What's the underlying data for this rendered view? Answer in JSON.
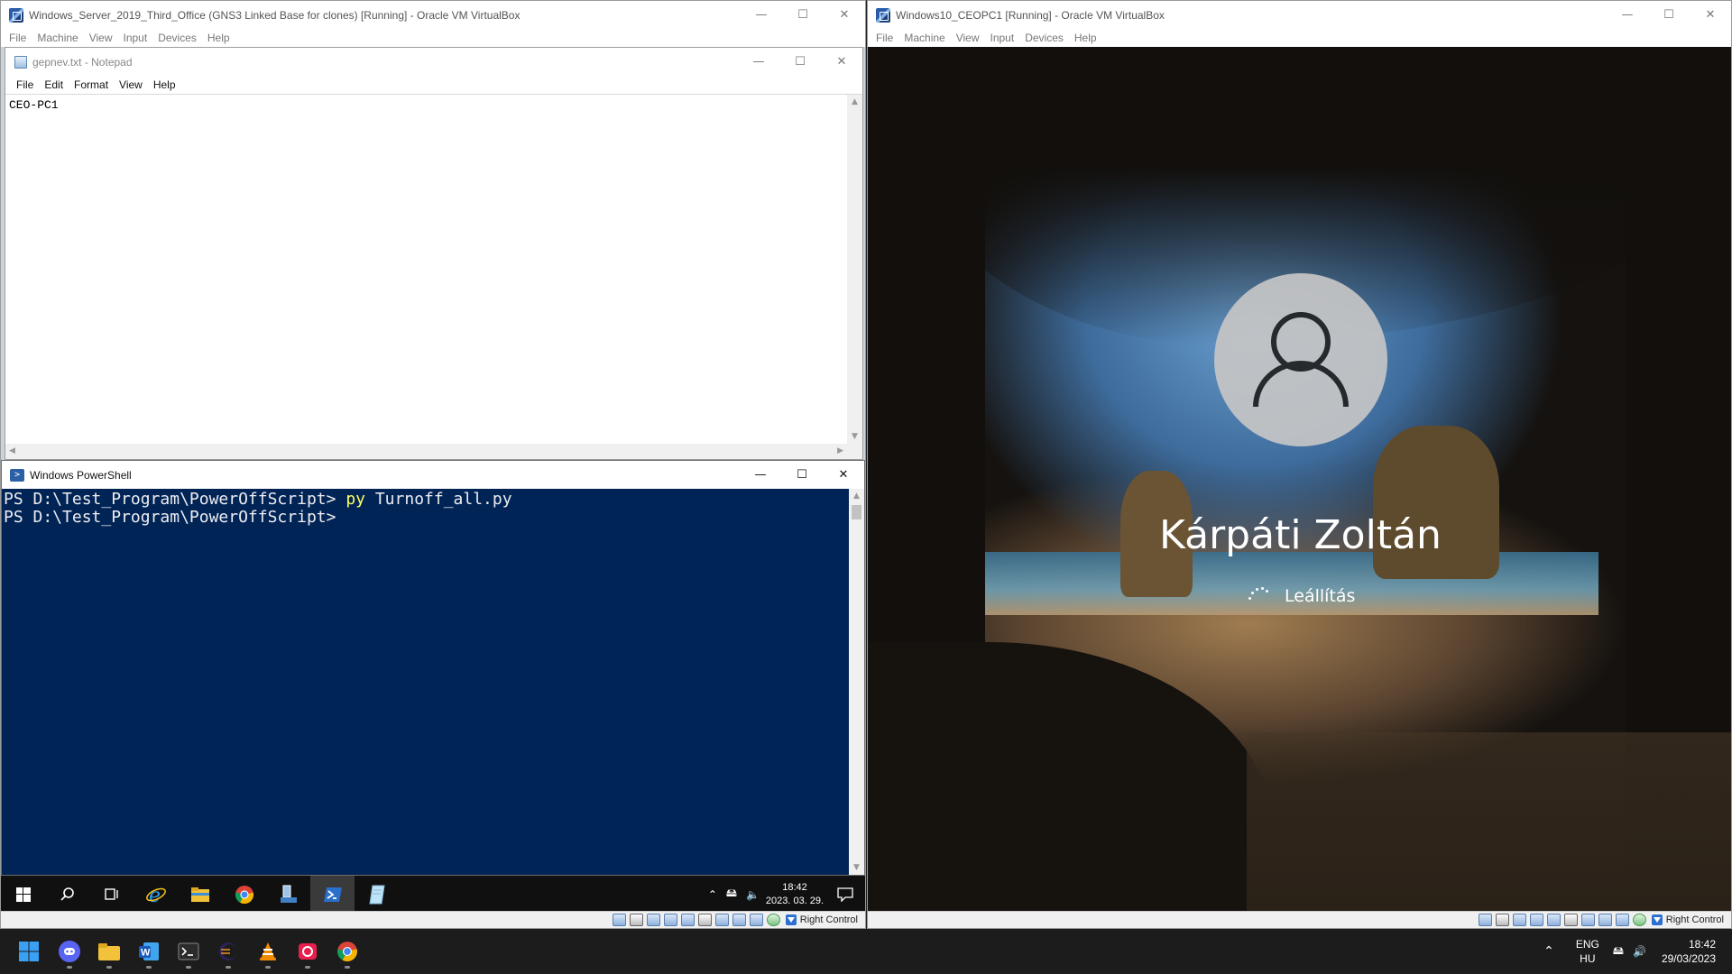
{
  "left_vbox": {
    "title": "Windows_Server_2019_Third_Office (GNS3 Linked Base for clones) [Running] - Oracle VM VirtualBox",
    "menu": [
      "File",
      "Machine",
      "View",
      "Input",
      "Devices",
      "Help"
    ],
    "status_label": "Right Control"
  },
  "notepad": {
    "title": "gepnev.txt - Notepad",
    "menu": [
      "File",
      "Edit",
      "Format",
      "View",
      "Help"
    ],
    "content": "CEO-PC1"
  },
  "powershell": {
    "title": "Windows PowerShell",
    "prompt": "PS D:\\Test_Program\\PowerOffScript>",
    "command": "py",
    "argument": "Turnoff_all.py"
  },
  "server_taskbar": {
    "time": "18:42",
    "date": "2023. 03. 29.",
    "icons": [
      "start-icon",
      "search-icon",
      "task-view-icon",
      "internet-explorer-icon",
      "file-explorer-icon",
      "chrome-icon",
      "server-manager-icon",
      "powershell-icon",
      "notepad-icon"
    ]
  },
  "right_vbox": {
    "title": "Windows10_CEOPC1 [Running] - Oracle VM VirtualBox",
    "menu": [
      "File",
      "Machine",
      "View",
      "Input",
      "Devices",
      "Help"
    ],
    "status_label": "Right Control"
  },
  "lockscreen": {
    "username": "Kárpáti Zoltán",
    "status": "Leállítás"
  },
  "host_taskbar": {
    "language_1": "ENG",
    "language_2": "HU",
    "time": "18:42",
    "date": "29/03/2023",
    "accent": "#0078d4"
  }
}
